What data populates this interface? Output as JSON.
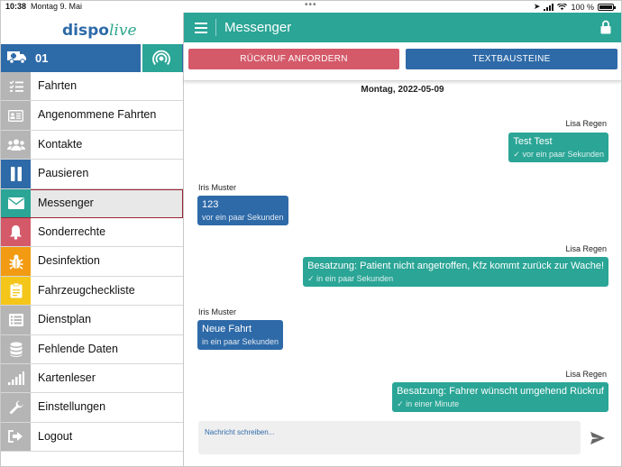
{
  "status_bar": {
    "time": "10:38",
    "date": "Montag 9. Mai",
    "battery": "100 %"
  },
  "sidebar": {
    "logo_main": "dispo",
    "logo_accent": "live",
    "vehicle_id": "01",
    "items": [
      {
        "label": "Fahrten",
        "icon": "list-check-icon",
        "color": "#b5b5b5"
      },
      {
        "label": "Angenommene Fahrten",
        "icon": "id-card-icon",
        "color": "#b5b5b5"
      },
      {
        "label": "Kontakte",
        "icon": "users-icon",
        "color": "#b5b5b5"
      },
      {
        "label": "Pausieren",
        "icon": "pause-icon",
        "color": "#2e6aa8"
      },
      {
        "label": "Messenger",
        "icon": "envelope-icon",
        "color": "#2aa596"
      },
      {
        "label": "Sonderrechte",
        "icon": "bell-icon",
        "color": "#d45a6a"
      },
      {
        "label": "Desinfektion",
        "icon": "bug-icon",
        "color": "#f29b12"
      },
      {
        "label": "Fahrzeugcheckliste",
        "icon": "clipboard-icon",
        "color": "#f3c619"
      },
      {
        "label": "Dienstplan",
        "icon": "list-icon",
        "color": "#b5b5b5"
      },
      {
        "label": "Fehlende Daten",
        "icon": "database-icon",
        "color": "#b5b5b5"
      },
      {
        "label": "Kartenleser",
        "icon": "signal-icon",
        "color": "#b5b5b5"
      },
      {
        "label": "Einstellungen",
        "icon": "wrench-icon",
        "color": "#b5b5b5"
      },
      {
        "label": "Logout",
        "icon": "sign-out-icon",
        "color": "#b5b5b5"
      }
    ]
  },
  "header": {
    "title": "Messenger"
  },
  "actions": {
    "rueckruf": "RÜCKRUF ANFORDERN",
    "textbausteine": "TEXTBAUSTEINE"
  },
  "chat": {
    "date": "Montag, 2022-05-09",
    "messages": [
      {
        "sender": "Lisa Regen",
        "text": "Test Test",
        "time": "vor ein paar Sekunden",
        "direction": "out"
      },
      {
        "sender": "Iris Muster",
        "text": "123",
        "time": "vor ein paar Sekunden",
        "direction": "in"
      },
      {
        "sender": "Lisa Regen",
        "text": "Besatzung: Patient nicht angetroffen, Kfz kommt zurück zur Wache!",
        "time": "in ein paar Sekunden",
        "direction": "out"
      },
      {
        "sender": "Iris Muster",
        "text": "Neue Fahrt",
        "time": "in ein paar Sekunden",
        "direction": "in"
      },
      {
        "sender": "Lisa Regen",
        "text": "Besatzung: Fahrer wünscht umgehend Rückruf",
        "time": "in einer Minute",
        "direction": "out"
      }
    ]
  },
  "composer": {
    "placeholder": "Nachricht schreiben..."
  },
  "colors": {
    "teal": "#2aa596",
    "blue": "#2e6aa8",
    "red": "#d45a6a"
  }
}
